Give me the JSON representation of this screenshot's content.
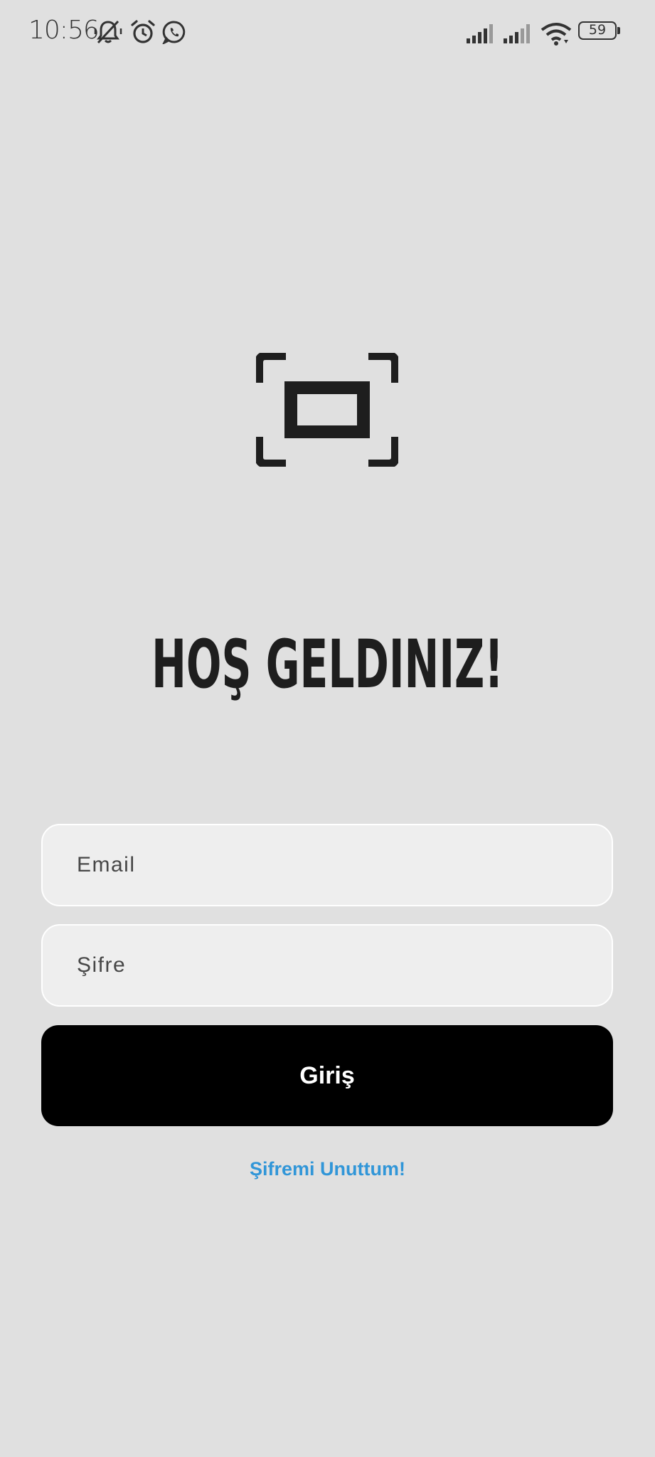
{
  "status_bar": {
    "time": "10:56",
    "battery": "59",
    "icons": [
      "mute-bell-icon",
      "alarm-icon",
      "whatsapp-icon",
      "signal-icon",
      "signal-icon",
      "wifi-icon",
      "battery-icon"
    ]
  },
  "logo": {
    "icon": "scan-frame-icon"
  },
  "title": "HOŞ GELDINIZ!",
  "form": {
    "email_placeholder": "Email",
    "password_placeholder": "Şifre",
    "login_label": "Giriş",
    "forgot_label": "Şifremi Unuttum!"
  },
  "colors": {
    "background": "#e0e0e0",
    "field_background": "#eeeeee",
    "button": "#000000",
    "link": "#3196d8",
    "title": "#1e1e1e"
  }
}
